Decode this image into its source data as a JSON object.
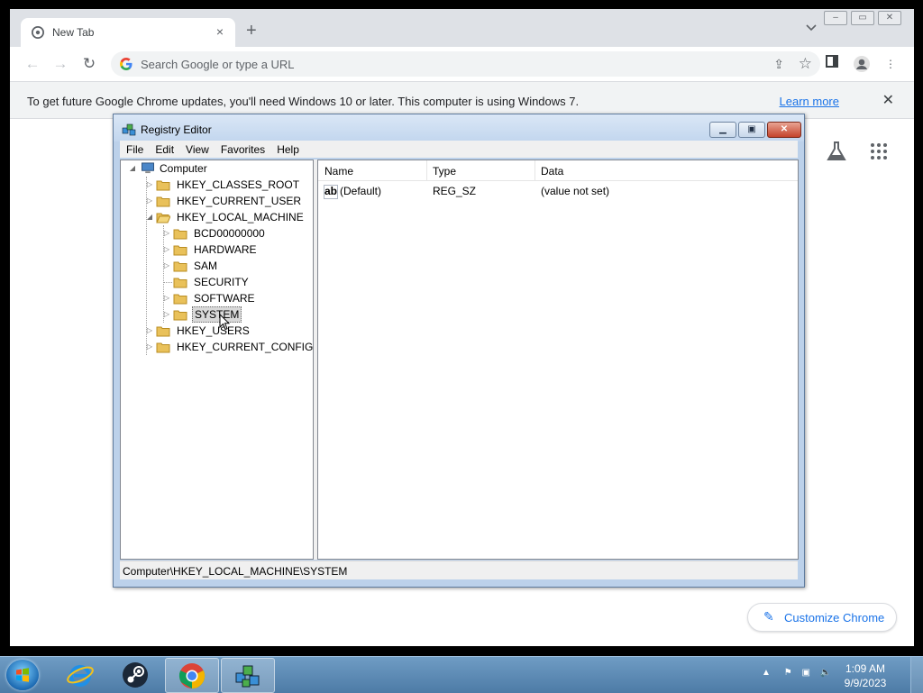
{
  "chrome": {
    "tab_title": "New Tab",
    "tab_close": "×",
    "new_tab": "+",
    "omnibox_placeholder": "Search Google or type a URL",
    "infobar_message": "To get future Google Chrome updates, you'll need Windows 10 or later. This computer is using Windows 7.",
    "infobar_link": "Learn more",
    "infobar_close": "✕",
    "customize_label": "Customize Chrome"
  },
  "regedit": {
    "title": "Registry Editor",
    "menu": [
      "File",
      "Edit",
      "View",
      "Favorites",
      "Help"
    ],
    "tree": [
      {
        "label": "Computer",
        "expanded": true
      },
      {
        "label": "HKEY_CLASSES_ROOT"
      },
      {
        "label": "HKEY_CURRENT_USER"
      },
      {
        "label": "HKEY_LOCAL_MACHINE",
        "expanded": true
      },
      {
        "label": "BCD00000000"
      },
      {
        "label": "HARDWARE"
      },
      {
        "label": "SAM"
      },
      {
        "label": "SECURITY"
      },
      {
        "label": "SOFTWARE"
      },
      {
        "label": "SYSTEM",
        "selected": true
      },
      {
        "label": "HKEY_USERS"
      },
      {
        "label": "HKEY_CURRENT_CONFIG"
      }
    ],
    "columns": [
      "Name",
      "Type",
      "Data"
    ],
    "values": [
      {
        "name": "(Default)",
        "type": "REG_SZ",
        "data": "(value not set)"
      }
    ],
    "status_path": "Computer\\HKEY_LOCAL_MACHINE\\SYSTEM"
  },
  "taskbar": {
    "time": "1:09 AM",
    "date": "9/9/2023",
    "apps": [
      "internet-explorer",
      "steam",
      "chrome",
      "registry-editor"
    ]
  }
}
